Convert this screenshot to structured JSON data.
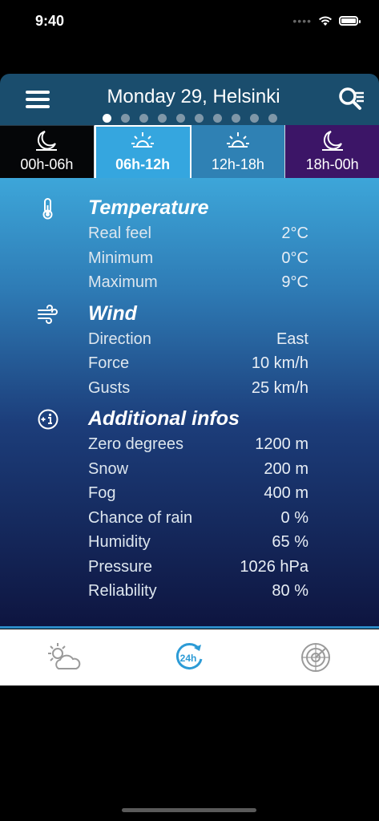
{
  "statusbar": {
    "time": "9:40"
  },
  "header": {
    "title": "Monday 29, Helsinki"
  },
  "pagination": {
    "count": 10,
    "active_index": 0
  },
  "tabs": [
    {
      "label": "00h-06h",
      "icon": "moon-icon"
    },
    {
      "label": "06h-12h",
      "icon": "sunrise-icon",
      "selected": true
    },
    {
      "label": "12h-18h",
      "icon": "sunrise-icon"
    },
    {
      "label": "18h-00h",
      "icon": "moon-icon"
    }
  ],
  "temperature": {
    "title": "Temperature",
    "rows": [
      {
        "label": "Real feel",
        "value": "2°C"
      },
      {
        "label": "Minimum",
        "value": "0°C"
      },
      {
        "label": "Maximum",
        "value": "9°C"
      }
    ]
  },
  "wind": {
    "title": "Wind",
    "rows": [
      {
        "label": "Direction",
        "value": "East"
      },
      {
        "label": "Force",
        "value": "10 km/h"
      },
      {
        "label": "Gusts",
        "value": "25 km/h"
      }
    ]
  },
  "additional": {
    "title": "Additional infos",
    "rows": [
      {
        "label": "Zero degrees",
        "value": "1200 m"
      },
      {
        "label": "Snow",
        "value": "200 m"
      },
      {
        "label": "Fog",
        "value": "400 m"
      },
      {
        "label": "Chance of rain",
        "value": "0 %"
      },
      {
        "label": "Humidity",
        "value": "65 %"
      },
      {
        "label": "Pressure",
        "value": "1026 hPa"
      },
      {
        "label": "Reliability",
        "value": "80 %"
      }
    ]
  },
  "bottom_nav": [
    {
      "icon": "partly-cloudy-icon"
    },
    {
      "icon": "24h-icon",
      "label": "24h",
      "active": true
    },
    {
      "icon": "radar-icon"
    }
  ],
  "colors": {
    "header_bg": "#1a4d6d",
    "tab_selected": "#35a6df",
    "tab_afternoon": "#2f81b4",
    "tab_evening": "#3c1567",
    "accent": "#2c9bd6"
  }
}
